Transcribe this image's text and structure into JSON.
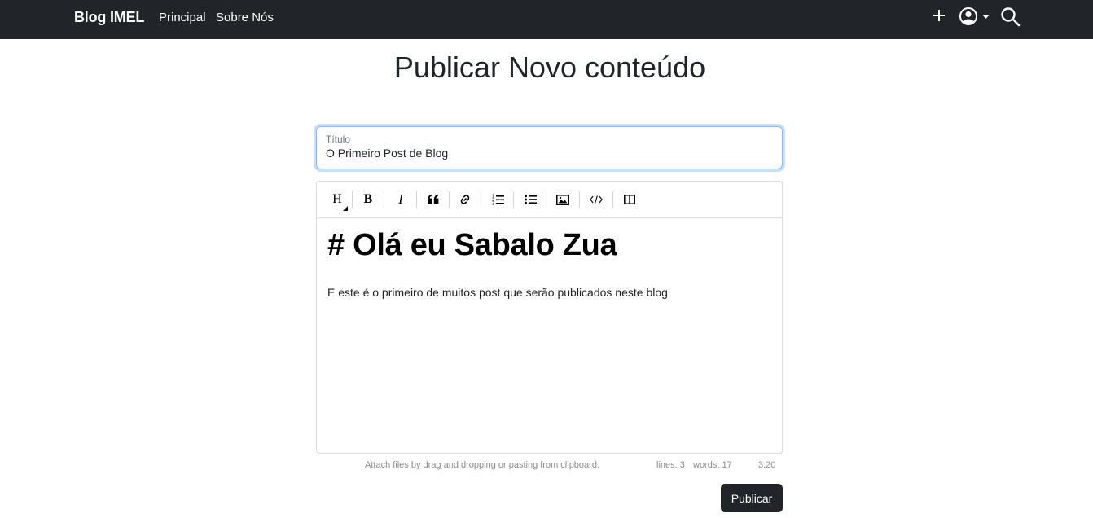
{
  "navbar": {
    "brand": "Blog IMEL",
    "links": [
      "Principal",
      "Sobre Nós"
    ],
    "icons": [
      "plus-icon",
      "user-circle-icon",
      "caret-down-icon",
      "search-icon"
    ],
    "background": "#212529"
  },
  "page": {
    "title": "Publicar Novo conteúdo"
  },
  "title_field": {
    "label": "Título",
    "value": "O Primeiro Post de Blog"
  },
  "editor": {
    "toolbar": [
      {
        "name": "heading",
        "glyph": "H"
      },
      {
        "name": "bold",
        "glyph": "B"
      },
      {
        "name": "italic",
        "glyph": "I"
      },
      {
        "name": "quote",
        "glyph": "quote-icon"
      },
      {
        "name": "link",
        "glyph": "link-icon"
      },
      {
        "name": "ordered-list",
        "glyph": "ordered-list-icon"
      },
      {
        "name": "unordered-list",
        "glyph": "unordered-list-icon"
      },
      {
        "name": "image",
        "glyph": "image-icon"
      },
      {
        "name": "code",
        "glyph": "code-icon"
      },
      {
        "name": "side-by-side",
        "glyph": "columns-icon"
      }
    ],
    "content": {
      "heading": "# Olá eu Sabalo Zua",
      "paragraph": "E este é o primeiro de muitos post que serão publicados neste blog"
    },
    "status": {
      "attach_hint": "Attach files by drag and dropping or pasting from clipboard.",
      "lines": "lines: 3",
      "words": "words: 17",
      "cursor": "3:20"
    }
  },
  "actions": {
    "publish_label": "Publicar"
  },
  "colors": {
    "dark": "#212529",
    "focus_border": "#86b7fe",
    "muted": "#8a8a8a"
  }
}
